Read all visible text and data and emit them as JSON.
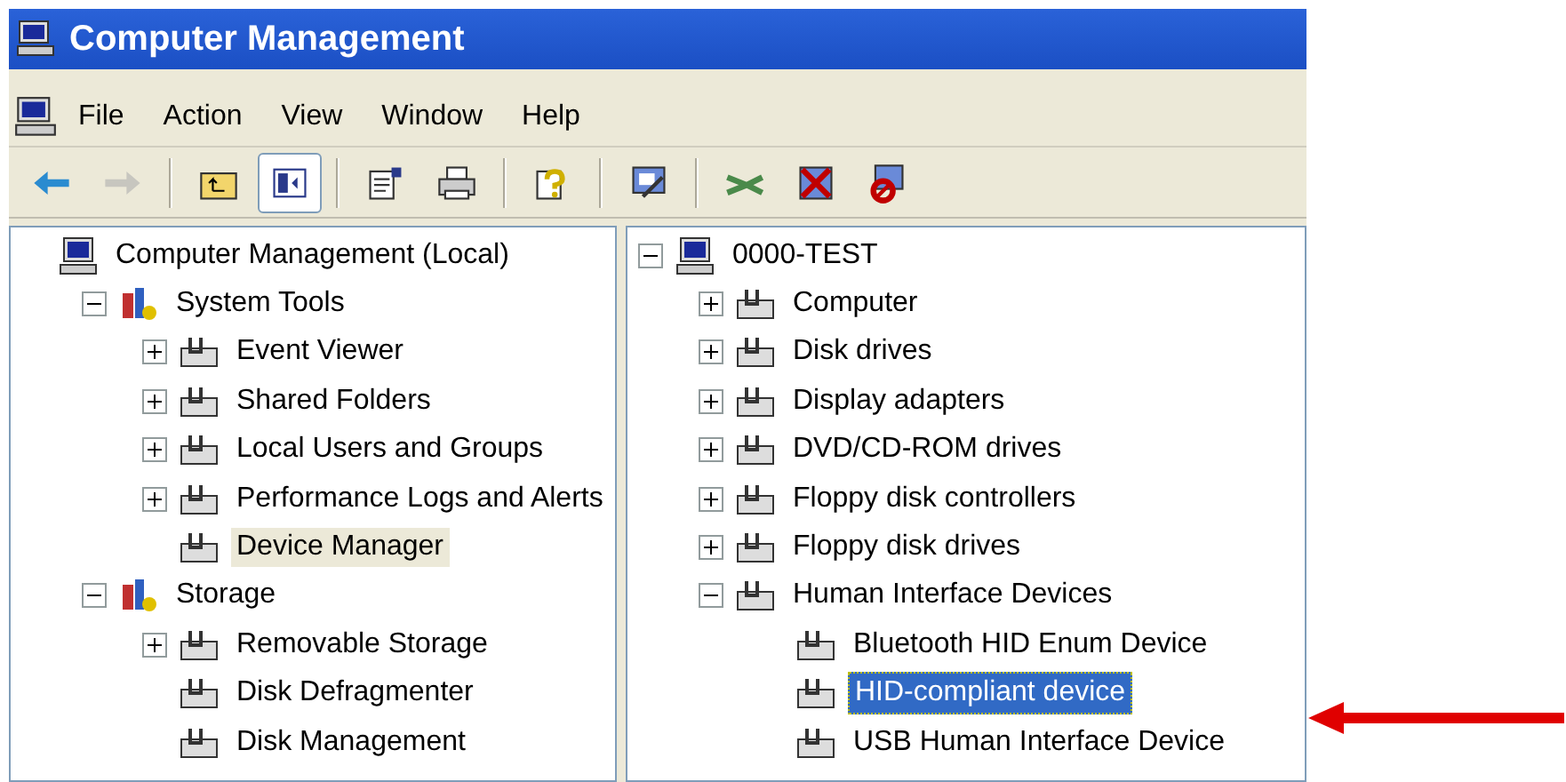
{
  "window": {
    "title": "Computer Management"
  },
  "menu": [
    "File",
    "Action",
    "View",
    "Window",
    "Help"
  ],
  "toolbar": [
    {
      "kind": "button",
      "disabled": false,
      "pressed": false
    },
    {
      "kind": "button",
      "disabled": true,
      "pressed": false
    },
    {
      "kind": "separator"
    },
    {
      "kind": "button",
      "disabled": false,
      "pressed": false
    },
    {
      "kind": "button",
      "disabled": false,
      "pressed": true
    },
    {
      "kind": "separator"
    },
    {
      "kind": "button",
      "disabled": false,
      "pressed": false
    },
    {
      "kind": "button",
      "disabled": false,
      "pressed": false
    },
    {
      "kind": "separator"
    },
    {
      "kind": "button",
      "disabled": false,
      "pressed": false
    },
    {
      "kind": "separator"
    },
    {
      "kind": "button",
      "disabled": false,
      "pressed": false
    },
    {
      "kind": "separator"
    },
    {
      "kind": "button",
      "disabled": false,
      "pressed": false
    },
    {
      "kind": "button",
      "disabled": false,
      "pressed": false
    },
    {
      "kind": "button",
      "disabled": false,
      "pressed": false
    }
  ],
  "console_tree": {
    "focused": false,
    "items": [
      {
        "label": "Computer Management (Local)",
        "selected": false,
        "children": [
          {
            "label": "System Tools",
            "expanded": true,
            "selected": false,
            "children": [
              {
                "label": "Event Viewer",
                "expanded": false,
                "selected": false
              },
              {
                "label": "Shared Folders",
                "expanded": false,
                "selected": false
              },
              {
                "label": "Local Users and Groups",
                "expanded": false,
                "selected": false
              },
              {
                "label": "Performance Logs and Alerts",
                "expanded": false,
                "selected": false
              },
              {
                "label": "Device Manager",
                "selected": true
              }
            ]
          },
          {
            "label": "Storage",
            "expanded": true,
            "selected": false,
            "children": [
              {
                "label": "Removable Storage",
                "expanded": false,
                "selected": false
              },
              {
                "label": "Disk Defragmenter",
                "selected": false
              },
              {
                "label": "Disk Management",
                "selected": false
              }
            ]
          }
        ]
      }
    ]
  },
  "device_tree": {
    "focused": true,
    "items": [
      {
        "label": "0000-TEST",
        "expanded": true,
        "selected": false,
        "children": [
          {
            "label": "Computer",
            "expanded": false,
            "selected": false
          },
          {
            "label": "Disk drives",
            "expanded": false,
            "selected": false
          },
          {
            "label": "Display adapters",
            "expanded": false,
            "selected": false
          },
          {
            "label": "DVD/CD-ROM drives",
            "expanded": false,
            "selected": false
          },
          {
            "label": "Floppy disk controllers",
            "expanded": false,
            "selected": false
          },
          {
            "label": "Floppy disk drives",
            "expanded": false,
            "selected": false
          },
          {
            "label": "Human Interface Devices",
            "expanded": true,
            "selected": false,
            "children": [
              {
                "label": "Bluetooth HID Enum Device",
                "selected": false
              },
              {
                "label": "HID-compliant device",
                "selected": true
              },
              {
                "label": "USB Human Interface Device",
                "selected": false
              }
            ]
          }
        ]
      }
    ]
  }
}
